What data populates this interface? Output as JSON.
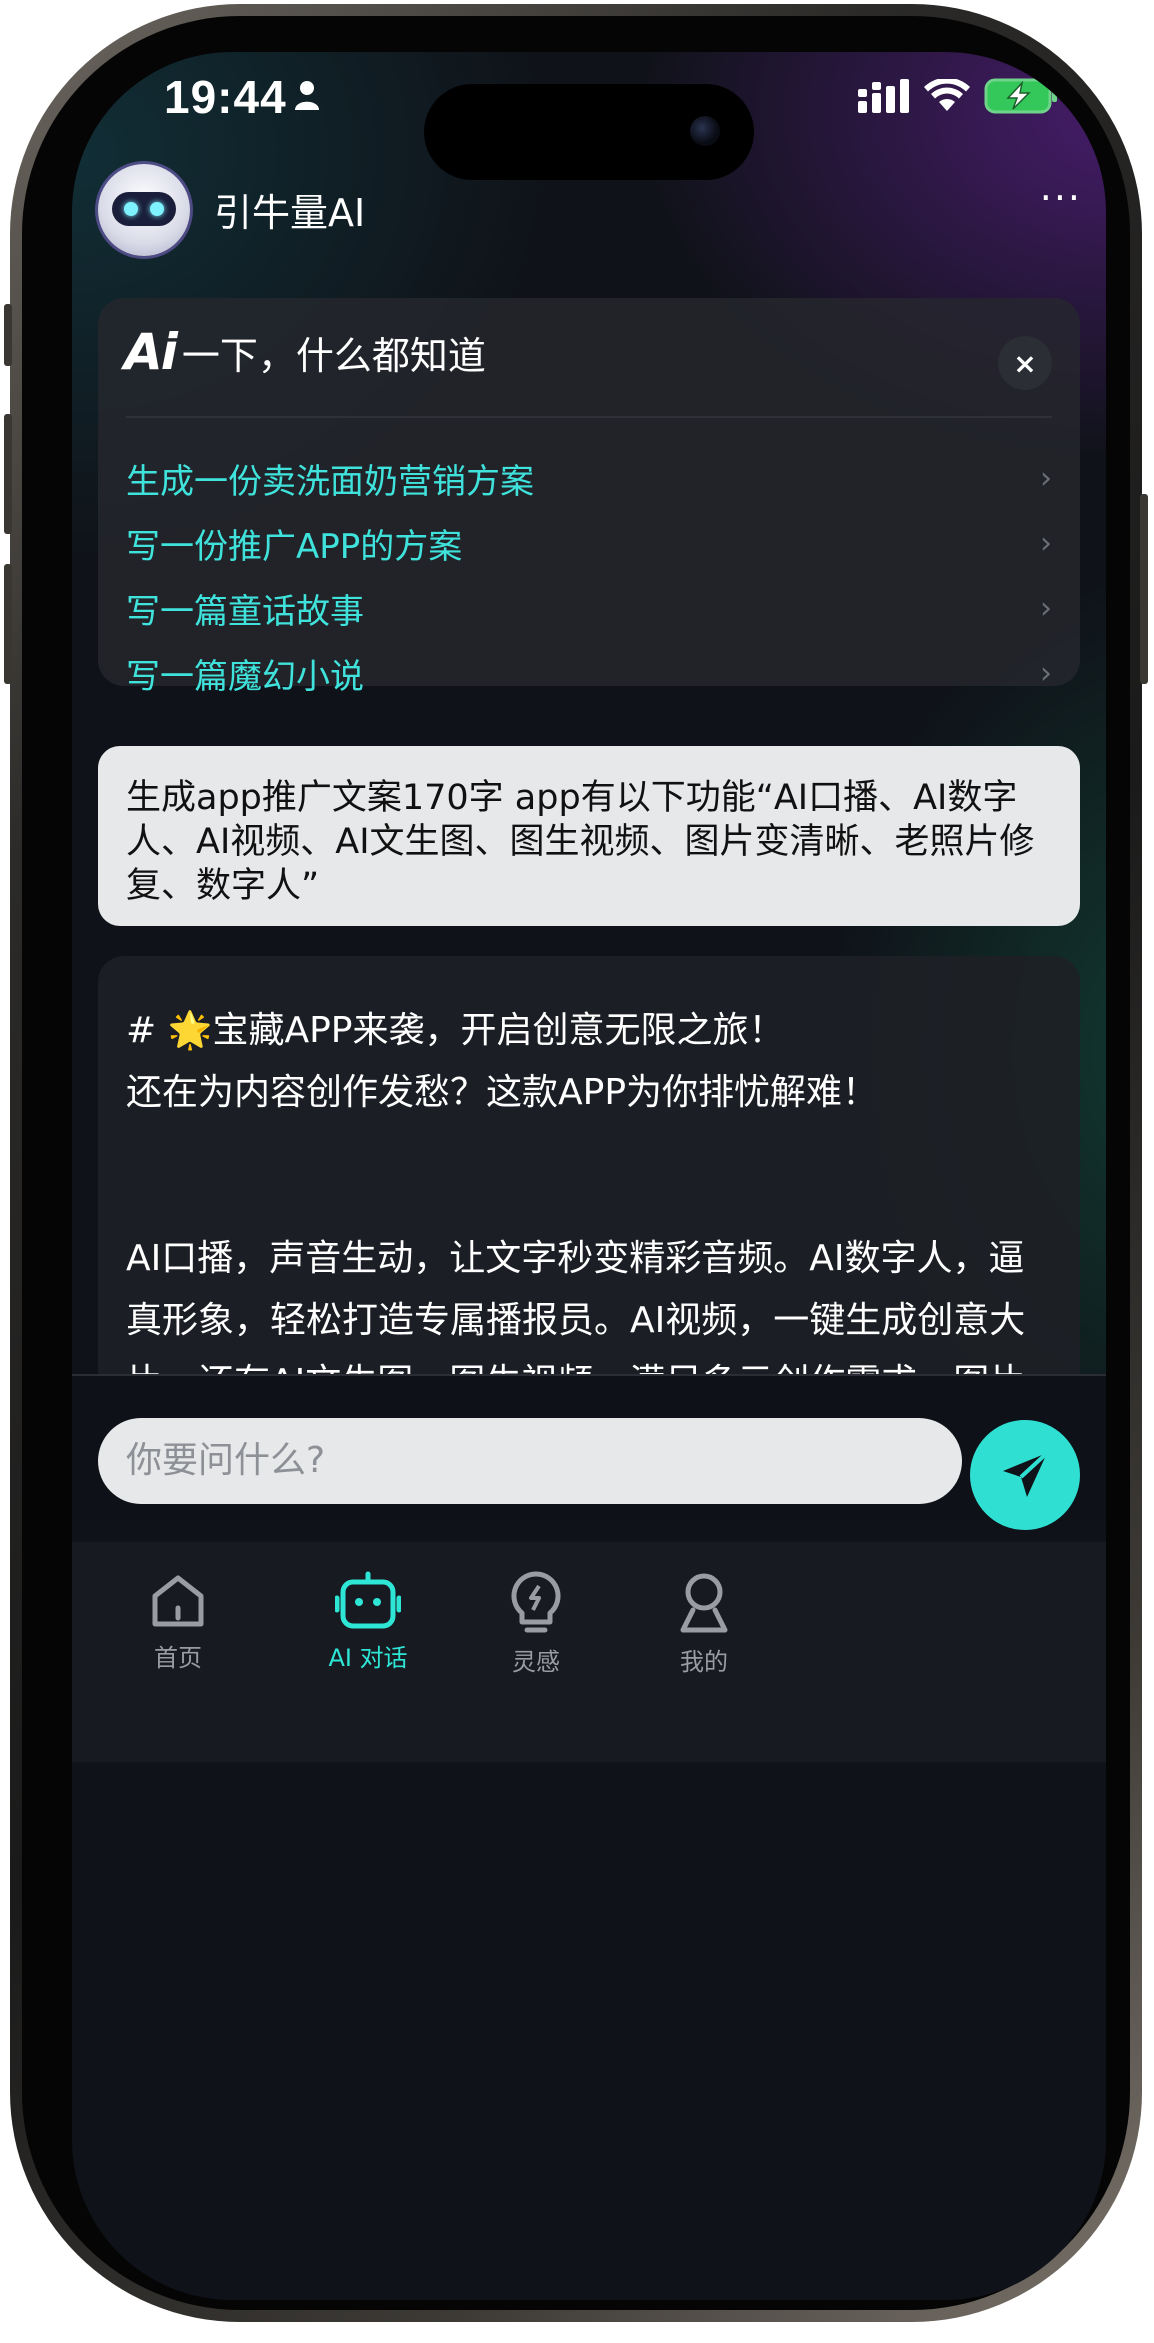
{
  "status_bar": {
    "time": "19:44"
  },
  "header": {
    "title": "引牛量AI",
    "more_label": "···"
  },
  "suggestions": {
    "logo_text": "Ai",
    "title": "一下，什么都知道",
    "close_label": "×",
    "items": [
      {
        "label": "生成一份卖洗面奶营销方案"
      },
      {
        "label": "写一份推广APP的方案"
      },
      {
        "label": "写一篇童话故事"
      },
      {
        "label": "写一篇魔幻小说"
      }
    ]
  },
  "conversation": {
    "user_message": "生成app推广文案170字 app有以下功能“AI口播、AI数字人、AI视频、AI文生图、图生视频、图片变清晰、老照片修复、数字人”",
    "ai_reply": {
      "heading_prefix": "# ",
      "heading_emoji": "🌟",
      "heading": "宝藏APP来袭，开启创意无限之旅！",
      "intro": "还在为内容创作发愁？这款APP为你排忧解难！",
      "body": "AI口播，声音生动，让文字秒变精彩音频。AI数字人，逼真形象，轻松打造专属播报员。AI视频，一键生成创意大片。还有AI文生图、图生视频，满足多元创作需求。图片变清晰、老照片修复，赋予旧图新生命。"
    }
  },
  "input": {
    "placeholder": "你要问什么?"
  },
  "tabbar": {
    "tabs": [
      {
        "label": "首页",
        "icon": "home-icon",
        "active": false
      },
      {
        "label": "AI 对话",
        "icon": "robot-icon",
        "active": true
      },
      {
        "label": "灵感",
        "icon": "lightbulb-icon",
        "active": false
      },
      {
        "label": "我的",
        "icon": "profile-icon",
        "active": false
      }
    ]
  },
  "colors": {
    "accent": "#2ee6d6",
    "suggestion_text": "#3fe3dc",
    "background": "#0f1218",
    "card": "#26282e",
    "bubble_light": "#e7e8ea"
  }
}
